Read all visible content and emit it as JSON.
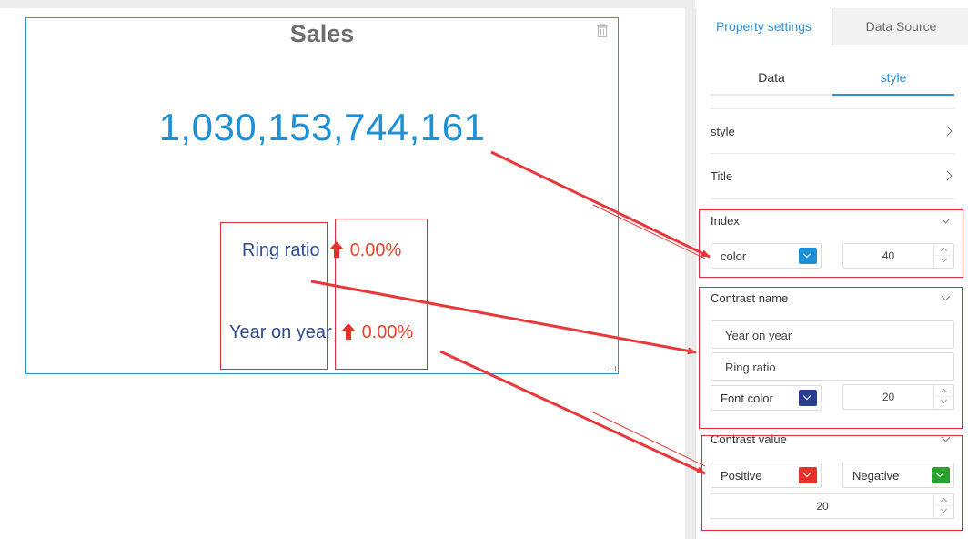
{
  "widget": {
    "title": "Sales",
    "main_value": "1,030,153,744,161",
    "rows": [
      {
        "label": "Ring ratio",
        "value": "0.00%"
      },
      {
        "label": "Year on year",
        "value": "0.00%"
      }
    ]
  },
  "panel": {
    "tabs": [
      {
        "label": "Property settings",
        "active": true
      },
      {
        "label": "Data Source",
        "active": false
      }
    ],
    "subtabs": [
      {
        "label": "Data",
        "active": false
      },
      {
        "label": "style",
        "active": true
      }
    ],
    "sections": {
      "style": "style",
      "title": "Title",
      "index": {
        "label": "Index",
        "color_label": "color",
        "color": "#1e90d5",
        "size": "40"
      },
      "contrast_name": {
        "label": "Contrast name",
        "name1": "Year on year",
        "name2": "Ring ratio",
        "font_color_label": "Font color",
        "font_color": "#2a3f8f",
        "size": "20"
      },
      "contrast_value": {
        "label": "Contrast value",
        "positive_label": "Positive",
        "positive_color": "#e8302a",
        "negative_label": "Negative",
        "negative_color": "#2aa12e",
        "size": "20"
      }
    }
  },
  "colors": {
    "accent": "#2d8fd8",
    "highlight": "#d9303a"
  }
}
